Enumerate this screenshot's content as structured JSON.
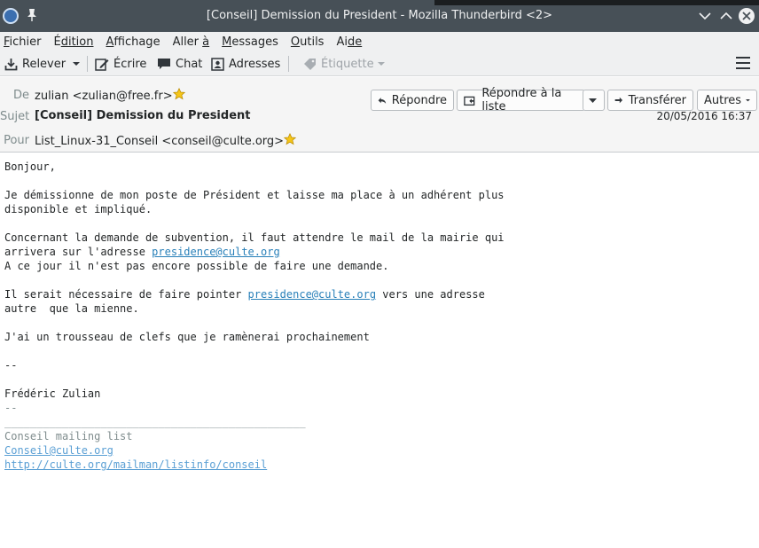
{
  "window": {
    "title": "[Conseil] Demission du President - Mozilla Thunderbird <2>"
  },
  "menu": [
    {
      "mnemonic": "F",
      "rest": "ichier"
    },
    {
      "mnemonic": "",
      "pre": "É",
      "rest": "dition"
    },
    {
      "mnemonic": "A",
      "rest": "ffichage"
    },
    {
      "mnemonic": "",
      "pre": "Aller ",
      "rest": "à"
    },
    {
      "mnemonic": "M",
      "rest": "essages"
    },
    {
      "mnemonic": "O",
      "rest": "utils"
    },
    {
      "mnemonic": "",
      "pre": "Ai",
      "rest": "de"
    }
  ],
  "toolbar": {
    "get_mail": "Relever",
    "write": "Écrire",
    "chat": "Chat",
    "address_book": "Adresses",
    "tag": "Étiquette"
  },
  "header": {
    "from_label": "De",
    "from_value": "zulian <zulian@free.fr>",
    "subject_label": "Sujet",
    "subject_value": "[Conseil] Demission du President",
    "to_label": "Pour",
    "to_value": "List_Linux-31_Conseil <conseil@culte.org>",
    "date": "20/05/2016 16:37",
    "buttons": {
      "reply": "Répondre",
      "reply_list": "Répondre à la liste",
      "forward": "Transférer",
      "other": "Autres"
    }
  },
  "body": {
    "l1": "Bonjour,",
    "l2": "Je démissionne de mon poste de Président et laisse ma place à un adhérent plus",
    "l3": "disponible et impliqué.",
    "l4": "Concernant la demande de subvention, il faut attendre le mail de la mairie qui",
    "l5_pre": "arrivera sur l'adresse ",
    "l5_link": "presidence@culte.org",
    "l6": "A ce jour il n'est pas encore possible de faire une demande.",
    "l7_pre": "Il serait nécessaire de faire pointer ",
    "l7_link": "presidence@culte.org",
    "l7_post": " vers une adresse",
    "l8": "autre  que la mienne.",
    "l9": "J'ai un trousseau de clefs que je ramènerai prochainement",
    "l10": "--",
    "l11": "Frédéric Zulian",
    "sig_sep": "--",
    "sig_rule": "_______________________________________________",
    "sig_list": "Conseil mailing list",
    "sig_email": "Conseil@culte.org",
    "sig_url": "http://culte.org/mailman/listinfo/conseil"
  },
  "colors": {
    "titlebar": "#475057",
    "link": "#2980b9",
    "star": "#f5c518"
  }
}
